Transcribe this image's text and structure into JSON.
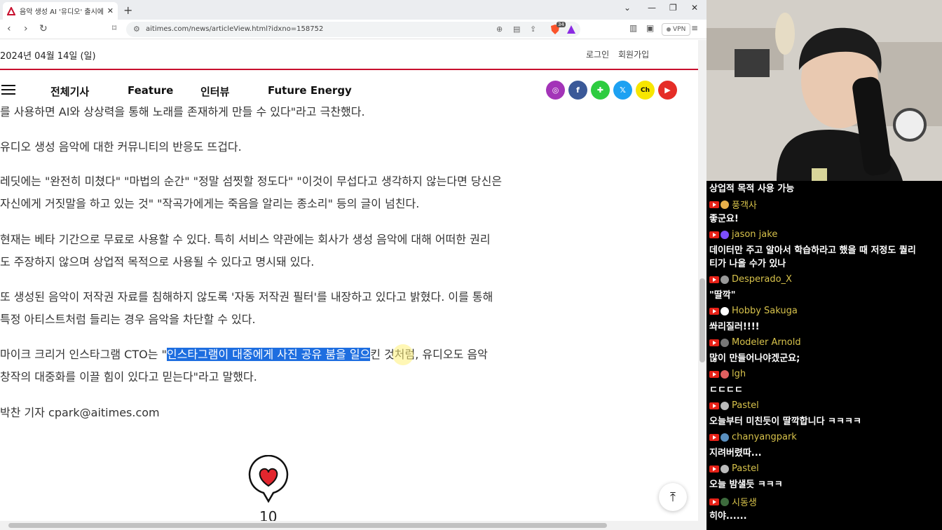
{
  "browser": {
    "tab_title": "음악 생성 AI '유디오' 출시에 \"C",
    "new_tab": "+",
    "url": "aitimes.com/news/articleView.html?idxno=158752",
    "vpn_label": "VPN",
    "extension_count": "34"
  },
  "header": {
    "date": "2024년 04월 14일 (일)",
    "login": "로그인",
    "signup": "회원가입"
  },
  "nav": {
    "items": [
      "전체기사",
      "Feature",
      "인터뷰",
      "Future Energy"
    ]
  },
  "social": [
    {
      "icon": "instagram-icon",
      "color": "#a334b8",
      "glyph": "◎"
    },
    {
      "icon": "facebook-icon",
      "color": "#3b5998",
      "glyph": "f"
    },
    {
      "icon": "kakao-story-icon",
      "color": "#2ecc40",
      "glyph": "✚"
    },
    {
      "icon": "x-twitter-icon",
      "color": "#1da1f2",
      "glyph": "𝕏"
    },
    {
      "icon": "kakao-channel-icon",
      "color": "#f7e600",
      "glyph": "Ch"
    },
    {
      "icon": "youtube-icon",
      "color": "#e52d27",
      "glyph": "▶"
    }
  ],
  "article": {
    "p0": "를 사용하면 AI와 상상력을 통해 노래를 존재하게 만들 수 있다\"라고 극찬했다.",
    "p1": "유디오 생성 음악에 대한 커뮤니티의 반응도 뜨겁다.",
    "p2_l1": "레딧에는 \"완전히 미쳤다\" \"마법의 순간\" \"정말 섬찟할 정도다\" \"이것이 무섭다고 생각하지 않는다면 당신은",
    "p2_l2": "자신에게 거짓말을 하고 있는 것\" \"작곡가에게는 죽음을 알리는 종소리\" 등의 글이 넘친다.",
    "p3_l1": "현재는 베타 기간으로 무료로 사용할 수 있다. 특히 서비스 약관에는 회사가 생성 음악에 대해 어떠한 권리",
    "p3_l2": "도 주장하지 않으며 상업적 목적으로 사용될 수 있다고 명시돼 있다.",
    "p4_l1": "또 생성된 음악이 저작권 자료를 침해하지 않도록 '자동 저작권 필터'를 내장하고 있다고 밝혔다. 이를 통해",
    "p4_l2": "특정 아티스트처럼 들리는 경우 음악을 차단할 수 있다.",
    "p5_pre": "마이크 크리거 인스타그램 CTO는 \"",
    "p5_hl": "인스타그램이 대중에게 사진 공유 붐을 일으",
    "p5_post": "킨 것처럼, 유디오도 음악",
    "p5_l2": "창작의 대중화를 이끌 힘이 있다고 믿는다\"라고 말했다.",
    "byline": "박찬 기자 cpark@aitimes.com",
    "like_count": "10"
  },
  "chat": {
    "top_line": "상업적 목적 사용 가능",
    "messages": [
      {
        "name": "풍객사",
        "text": "좋군요!"
      },
      {
        "name": "jason jake",
        "text": "데이터만 주고 알아서 학습하라고 했을 때 저정도 퀄리",
        "text2": "티가 나올 수가 있나"
      },
      {
        "name": "Desperado_X",
        "text": "\"딸깍\""
      },
      {
        "name": "Hobby Sakuga",
        "text": "쏴리질러!!!!"
      },
      {
        "name": "Modeler Arnold",
        "text": "많이 만들어나야겠군요;"
      },
      {
        "name": "lgh",
        "text": "ㄷㄷㄷㄷ"
      },
      {
        "name": "Pastel",
        "text": "오늘부터 미친듯이 딸깍합니다 ㅋㅋㅋㅋ"
      },
      {
        "name": "chanyangpark",
        "text": "지려버렸따..."
      },
      {
        "name": "Pastel",
        "text": "오늘 밤샐듯 ㅋㅋㅋ"
      },
      {
        "name": "시동생",
        "text": "히야......"
      }
    ]
  }
}
